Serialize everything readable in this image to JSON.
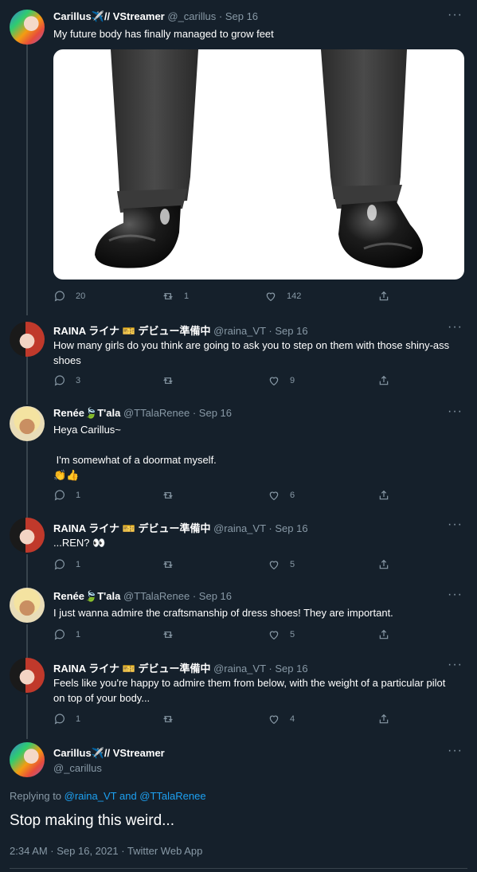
{
  "tweets": [
    {
      "name": "Carillus✈️// VStreamer",
      "handle": "@_carillus",
      "date": "· Sep 16",
      "text": "My future body has finally managed to grow feet",
      "replies": "20",
      "retweets": "1",
      "likes": "142"
    },
    {
      "name": "RAINA ライナ 🎫 デビュー準備中",
      "handle": "@raina_VT",
      "date": "· Sep 16",
      "text": "How many girls do you think are going to ask you to step on them with those shiny-ass shoes",
      "replies": "3",
      "retweets": "",
      "likes": "9"
    },
    {
      "name": "Renée🍃T'ala",
      "handle": "@TTalaRenee",
      "date": "· Sep 16",
      "text": "Heya Carillus~\n\n I'm somewhat of a doormat myself.\n👏👍",
      "replies": "1",
      "retweets": "",
      "likes": "6"
    },
    {
      "name": "RAINA ライナ 🎫 デビュー準備中",
      "handle": "@raina_VT",
      "date": "· Sep 16",
      "text": "...REN? 👀",
      "replies": "1",
      "retweets": "",
      "likes": "5"
    },
    {
      "name": "Renée🍃T'ala",
      "handle": "@TTalaRenee",
      "date": "· Sep 16",
      "text": "I just wanna admire the craftsmanship of dress shoes! They are important.",
      "replies": "1",
      "retweets": "",
      "likes": "5"
    },
    {
      "name": "RAINA ライナ 🎫 デビュー準備中",
      "handle": "@raina_VT",
      "date": "· Sep 16",
      "text": "Feels like you're happy to admire them from below, with the weight of a particular pilot on top of your body...",
      "replies": "1",
      "retweets": "",
      "likes": "4"
    }
  ],
  "focused": {
    "name": "Carillus✈️// VStreamer",
    "handle": "@_carillus",
    "replying_prefix": "Replying to ",
    "replying_user1": "@raina_VT",
    "replying_and": " and ",
    "replying_user2": "@TTalaRenee",
    "text": "Stop making this weird...",
    "timestamp": "2:34 AM · Sep 16, 2021 · Twitter Web App"
  },
  "more_label": "···",
  "colors": {
    "background": "#15202b",
    "muted": "#8899a6",
    "link": "#1da1f2"
  },
  "icons": [
    "reply-icon",
    "retweet-icon",
    "like-icon",
    "share-icon",
    "more-icon"
  ]
}
